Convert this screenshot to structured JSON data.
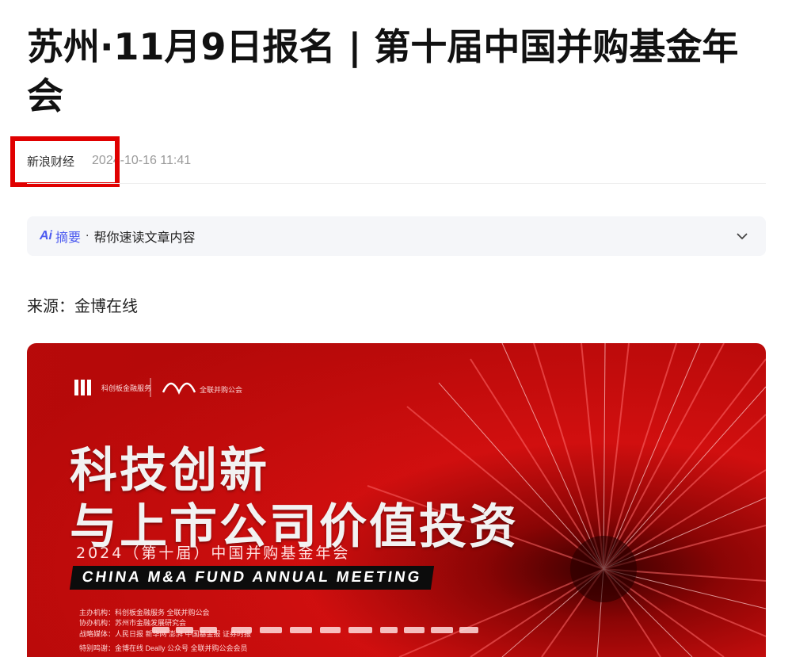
{
  "article": {
    "title": "苏州·11月9日报名 | 第十届中国并购基金年会",
    "author": "新浪财经",
    "timestamp": "2024-10-16 11:41",
    "source_line": "来源：金博在线"
  },
  "summary": {
    "icon_text": "Ai",
    "label": "摘要",
    "separator": "·",
    "description": "帮你速读文章内容",
    "toggle_icon": "chevron-down-icon"
  },
  "banner": {
    "logo_text": "科创板金融服务",
    "association_text": "全联并购公会",
    "headline_line1": "科技创新",
    "headline_line2": "与上市公司价值投资",
    "subtitle": "2024（第十届）中国并购基金年会",
    "english_title": "CHINA M&A FUND ANNUAL MEETING",
    "organizers_line": "主办机构：科创板金融服务 全联并购公会",
    "co_organizers_line": "协办机构：苏州市金融发展研究会",
    "media_line": "战略媒体：人民日报 新华网 澎湃 中国基金报 证券时报",
    "support_line": "特别鸣谢：金博在线 Deally 公众号 全联并购公会会员"
  },
  "colors": {
    "highlight_border": "#e00000",
    "ai_accent": "#4d5bf0",
    "banner_red": "#d10f0f"
  }
}
